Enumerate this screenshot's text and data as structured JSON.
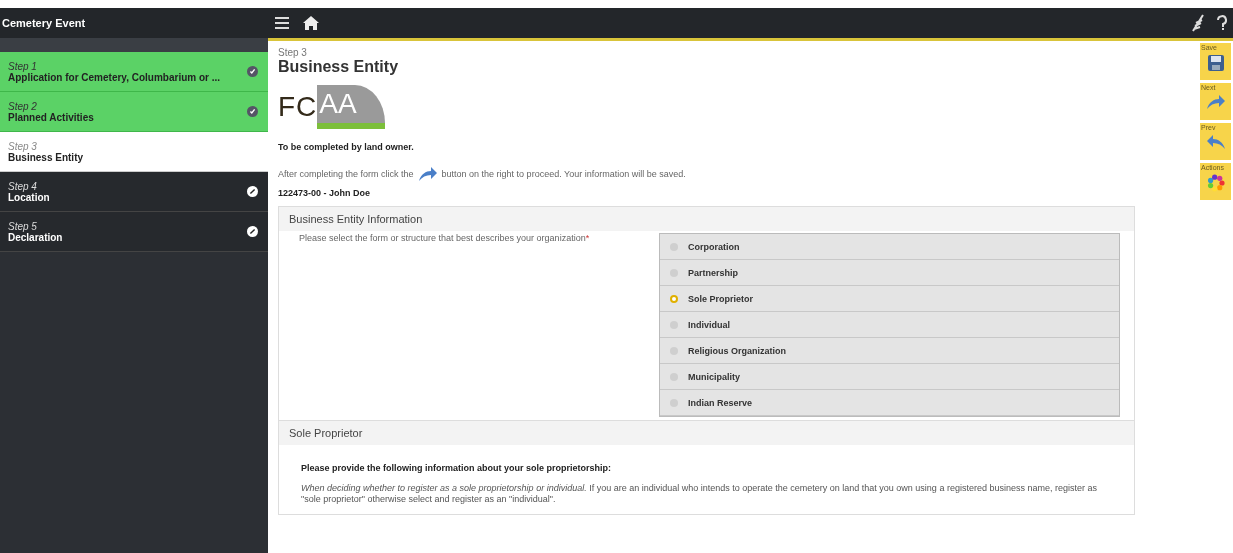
{
  "sidebar": {
    "title": "Cemetery Event",
    "steps": [
      {
        "step": "Step 1",
        "name": "Application for Cemetery, Columbarium or ...",
        "completed": true,
        "selected": false
      },
      {
        "step": "Step 2",
        "name": "Planned Activities",
        "completed": true,
        "selected": false
      },
      {
        "step": "Step 3",
        "name": "Business Entity",
        "completed": false,
        "selected": true
      },
      {
        "step": "Step 4",
        "name": "Location",
        "completed": false,
        "selected": false
      },
      {
        "step": "Step 5",
        "name": "Declaration",
        "completed": false,
        "selected": false
      }
    ]
  },
  "page": {
    "step": "Step 3",
    "title": "Business Entity",
    "logo": {
      "dark": "FC",
      "light": "AA"
    },
    "owner_note": "To be completed by land owner.",
    "instruction_before": "After completing the form click the",
    "instruction_after": "button on the right to proceed. Your information will be saved.",
    "applicant": "122473-00 - John Doe"
  },
  "business_entity": {
    "heading": "Business Entity Information",
    "question": "Please select the form or structure that best describes your organization",
    "required_mark": "*",
    "options": [
      {
        "label": "Corporation",
        "selected": false
      },
      {
        "label": "Partnership",
        "selected": false
      },
      {
        "label": "Sole Proprietor",
        "selected": true
      },
      {
        "label": "Individual",
        "selected": false
      },
      {
        "label": "Religious Organization",
        "selected": false
      },
      {
        "label": "Municipality",
        "selected": false
      },
      {
        "label": "Indian Reserve",
        "selected": false
      }
    ]
  },
  "sole_proprietor": {
    "heading": "Sole Proprietor",
    "prompt": "Please provide the following information about your sole proprietorship:",
    "note": "*When deciding whether to register as a sole proprietorship or individual.* If you are an individual who intends to operate the cemetery on land that you own using a registered business name, register as \"sole proprietor\" otherwise select and register as an \"individual\"."
  },
  "toolbar": [
    {
      "kind": "save",
      "label": "Save"
    },
    {
      "kind": "next",
      "label": "Next"
    },
    {
      "kind": "prev",
      "label": "Prev"
    },
    {
      "kind": "actions",
      "label": "Actions"
    }
  ]
}
